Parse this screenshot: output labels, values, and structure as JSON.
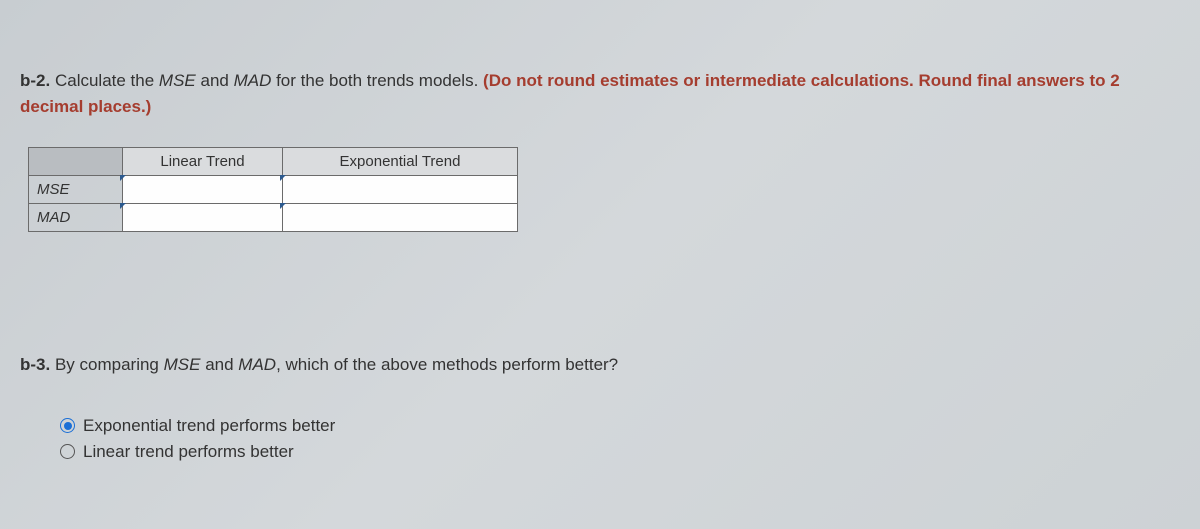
{
  "q1": {
    "prefix": "b-2.",
    "text_part1": " Calculate the ",
    "mse": "MSE",
    "text_and1": " and ",
    "mad": "MAD",
    "text_part2": " for the both trends models. ",
    "instruction": "(Do not round estimates or intermediate calculations. Round final answers to 2 decimal places.)"
  },
  "table": {
    "headers": {
      "linear": "Linear Trend",
      "exponential": "Exponential Trend"
    },
    "rows": {
      "r0_label": "MSE",
      "r1_label": "MAD"
    },
    "values": {
      "r0_linear": "",
      "r0_exp": "",
      "r1_linear": "",
      "r1_exp": ""
    }
  },
  "q2": {
    "prefix": "b-3.",
    "text_part1": " By comparing ",
    "mse": "MSE",
    "text_and1": " and ",
    "mad": "MAD",
    "text_part2": ", which of the above methods perform better?"
  },
  "options": {
    "opt1_label": "Exponential trend performs better",
    "opt2_label": "Linear trend performs better"
  }
}
